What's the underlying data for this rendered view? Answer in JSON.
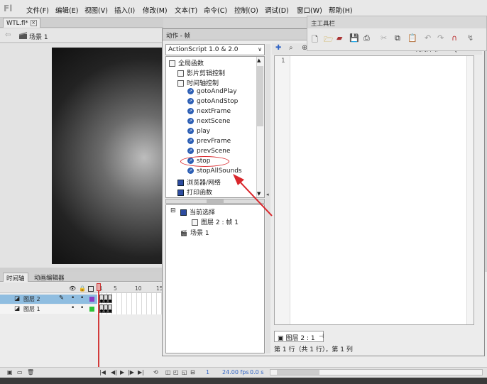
{
  "app_logo": "Fl",
  "menu": [
    "文件(F)",
    "编辑(E)",
    "视图(V)",
    "插入(I)",
    "修改(M)",
    "文本(T)",
    "命令(C)",
    "控制(O)",
    "调试(D)",
    "窗口(W)",
    "帮助(H)"
  ],
  "document_tab": {
    "name": "WTL.fl*"
  },
  "scene_bar": {
    "scene": "场景 1"
  },
  "actions_panel": {
    "title": "动作 - 帧",
    "version_select": "ActionScript 1.0 & 2.0",
    "tree": [
      {
        "label": "全局函数",
        "icon": "book-icon",
        "indent": 0
      },
      {
        "label": "影片剪辑控制",
        "icon": "book-icon",
        "indent": 1
      },
      {
        "label": "时间轴控制",
        "icon": "book-icon",
        "indent": 1
      },
      {
        "label": "gotoAndPlay",
        "icon": "function-icon",
        "indent": 2
      },
      {
        "label": "gotoAndStop",
        "icon": "function-icon",
        "indent": 2
      },
      {
        "label": "nextFrame",
        "icon": "function-icon",
        "indent": 2
      },
      {
        "label": "nextScene",
        "icon": "function-icon",
        "indent": 2
      },
      {
        "label": "play",
        "icon": "function-icon",
        "indent": 2
      },
      {
        "label": "prevFrame",
        "icon": "function-icon",
        "indent": 2
      },
      {
        "label": "prevScene",
        "icon": "function-icon",
        "indent": 2
      },
      {
        "label": "stop",
        "icon": "function-icon",
        "indent": 2
      },
      {
        "label": "stopAllSounds",
        "icon": "function-icon",
        "indent": 2
      },
      {
        "label": "浏览器/网络",
        "icon": "book-icon",
        "indent": 1
      },
      {
        "label": "打印函数",
        "icon": "book-icon",
        "indent": 1
      }
    ],
    "selection_tree": {
      "current_selection": "当前选择",
      "layer_frame": "图层 2 : 帧 1",
      "scene": "场景 1"
    },
    "code_hint": "代码片断",
    "line_number": "1",
    "script_tab": "图层 2 : 1",
    "status": "第 1 行（共 1 行），第 1 列"
  },
  "main_toolbar": {
    "title": "主工具栏"
  },
  "timeline": {
    "tabs": [
      "时间轴",
      "动画编辑器"
    ],
    "frame_numbers": [
      "1",
      "5",
      "10",
      "15"
    ],
    "layers": [
      {
        "name": "图层 2",
        "selected": true,
        "color": "#8a3bc4"
      },
      {
        "name": "图层 1",
        "selected": false,
        "color": "#2fc238"
      }
    ],
    "current_frame": "1",
    "fps": "24.00 fps",
    "time": "0.0 s"
  },
  "colors": {
    "annotation_red": "#d9262b",
    "selection_blue": "#8fbde0"
  }
}
